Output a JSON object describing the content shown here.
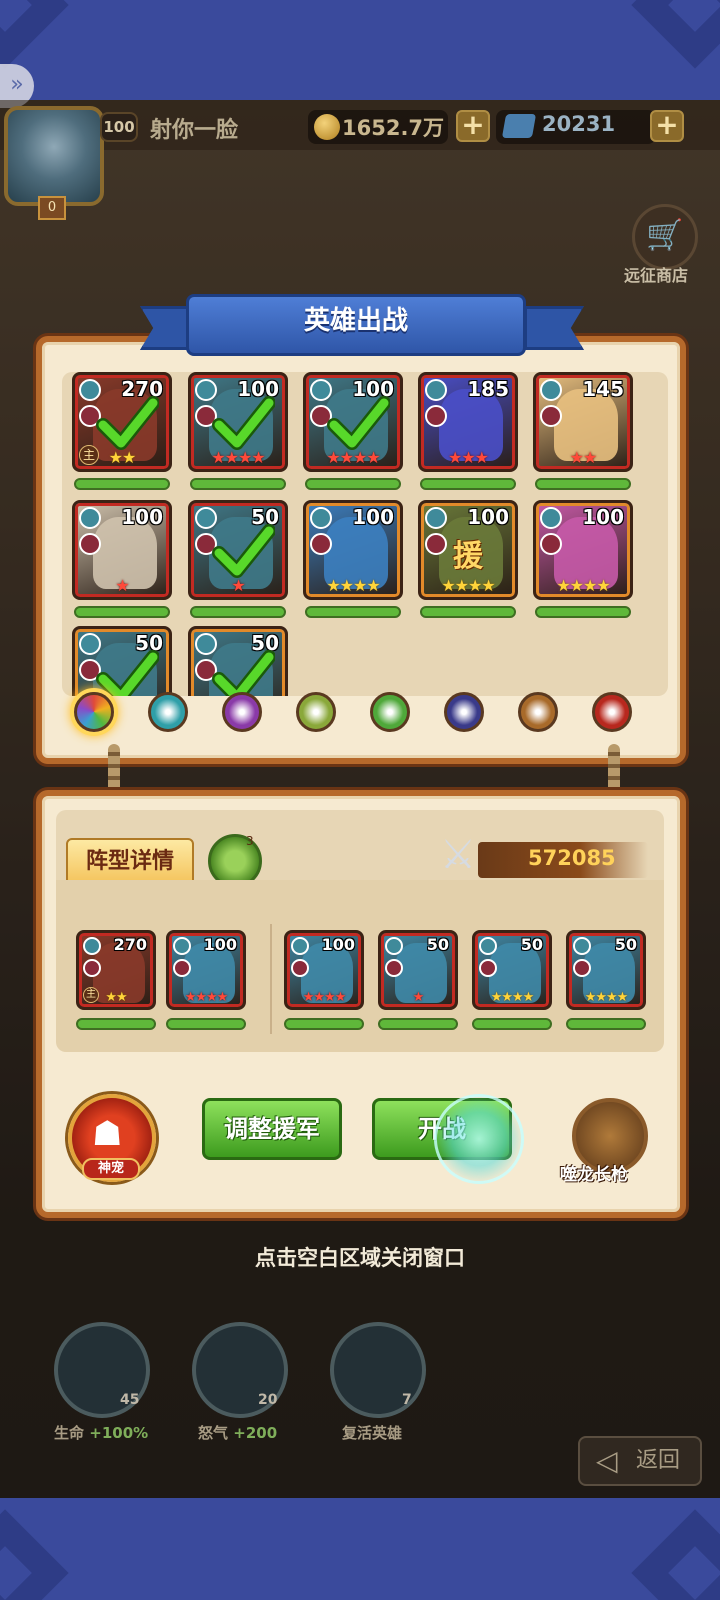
{
  "player": {
    "level": "100",
    "name": "射你一脸",
    "avatar_badge": "0",
    "gold": "1652.7万",
    "gems": "20231"
  },
  "shop": {
    "label": "远征商店"
  },
  "panel": {
    "title": "英雄出战",
    "heroes": [
      {
        "level": "270",
        "selected": true,
        "stars": "★★",
        "star_color": "gold",
        "main": "主",
        "frame": "red",
        "color": "#8a3a2a"
      },
      {
        "level": "100",
        "selected": true,
        "stars": "★★★★",
        "star_color": "red",
        "frame": "red",
        "color": "#3f7a8a"
      },
      {
        "level": "100",
        "selected": true,
        "stars": "★★★★",
        "star_color": "red",
        "frame": "red",
        "color": "#3f7a8a"
      },
      {
        "level": "185",
        "selected": false,
        "stars": "★★★",
        "star_color": "red",
        "frame": "red",
        "color": "#4a4fc8"
      },
      {
        "level": "145",
        "selected": false,
        "stars": "★★",
        "star_color": "red",
        "frame": "red",
        "color": "#e8c080"
      },
      {
        "level": "100",
        "selected": false,
        "stars": "★",
        "star_color": "red",
        "frame": "red",
        "color": "#cfc2ad"
      },
      {
        "level": "50",
        "selected": true,
        "stars": "★",
        "star_color": "red",
        "frame": "red",
        "color": "#3f7a8a"
      },
      {
        "level": "100",
        "selected": false,
        "stars": "★★★★",
        "star_color": "gold",
        "frame": "orange",
        "color": "#3c7fc0"
      },
      {
        "level": "100",
        "selected": false,
        "stars": "★★★★",
        "star_color": "gold",
        "frame": "orange",
        "aid": "援",
        "color": "#6a7a3a"
      },
      {
        "level": "100",
        "selected": false,
        "stars": "★★★★",
        "star_color": "gold",
        "frame": "orange",
        "color": "#c75aa8"
      },
      {
        "level": "50",
        "selected": true,
        "stars": "",
        "star_color": "gold",
        "frame": "orange",
        "color": "#3f7a8a"
      },
      {
        "level": "50",
        "selected": true,
        "stars": "",
        "star_color": "gold",
        "frame": "orange",
        "color": "#3f7a8a"
      }
    ],
    "filters": [
      {
        "name": "all",
        "color": "#e0e0e0",
        "selected": true
      },
      {
        "name": "water",
        "color": "#2f9fa8"
      },
      {
        "name": "dark",
        "color": "#8a3aa8"
      },
      {
        "name": "earth",
        "color": "#8aa83a"
      },
      {
        "name": "nature",
        "color": "#4fa83a"
      },
      {
        "name": "shadow",
        "color": "#3a3a8a"
      },
      {
        "name": "light",
        "color": "#a86a2a"
      },
      {
        "name": "fire",
        "color": "#b8281e"
      }
    ]
  },
  "formation": {
    "details_label": "阵型详情",
    "formation_level": "3",
    "power": "572085",
    "team": [
      {
        "level": "270",
        "stars": "★★",
        "star_color": "gold",
        "main": "主",
        "color": "#8a3a2a"
      },
      {
        "level": "100",
        "stars": "★★★★",
        "star_color": "red",
        "color": "#3f8aa8"
      },
      {
        "level": "100",
        "stars": "★★★★",
        "star_color": "red",
        "color": "#3f8aa8"
      },
      {
        "level": "50",
        "stars": "★",
        "star_color": "red",
        "color": "#3f8aa8"
      },
      {
        "level": "50",
        "stars": "★★★★",
        "star_color": "gold",
        "color": "#3f8aa8"
      },
      {
        "level": "50",
        "stars": "★★★★",
        "star_color": "gold",
        "color": "#3f8aa8"
      }
    ],
    "pet_label": "神宠",
    "adjust_button": "调整援军",
    "fight_button": "开战",
    "weapon_label": "噬龙长枪"
  },
  "close_hint": "点击空白区域关闭窗口",
  "consumables": [
    {
      "label": "生命",
      "bonus": "+100%",
      "count": "45"
    },
    {
      "label": "怒气",
      "bonus": "+200",
      "count": "20"
    },
    {
      "label": "复活英雄",
      "bonus": "",
      "count": "7"
    }
  ],
  "back_button": "返回"
}
